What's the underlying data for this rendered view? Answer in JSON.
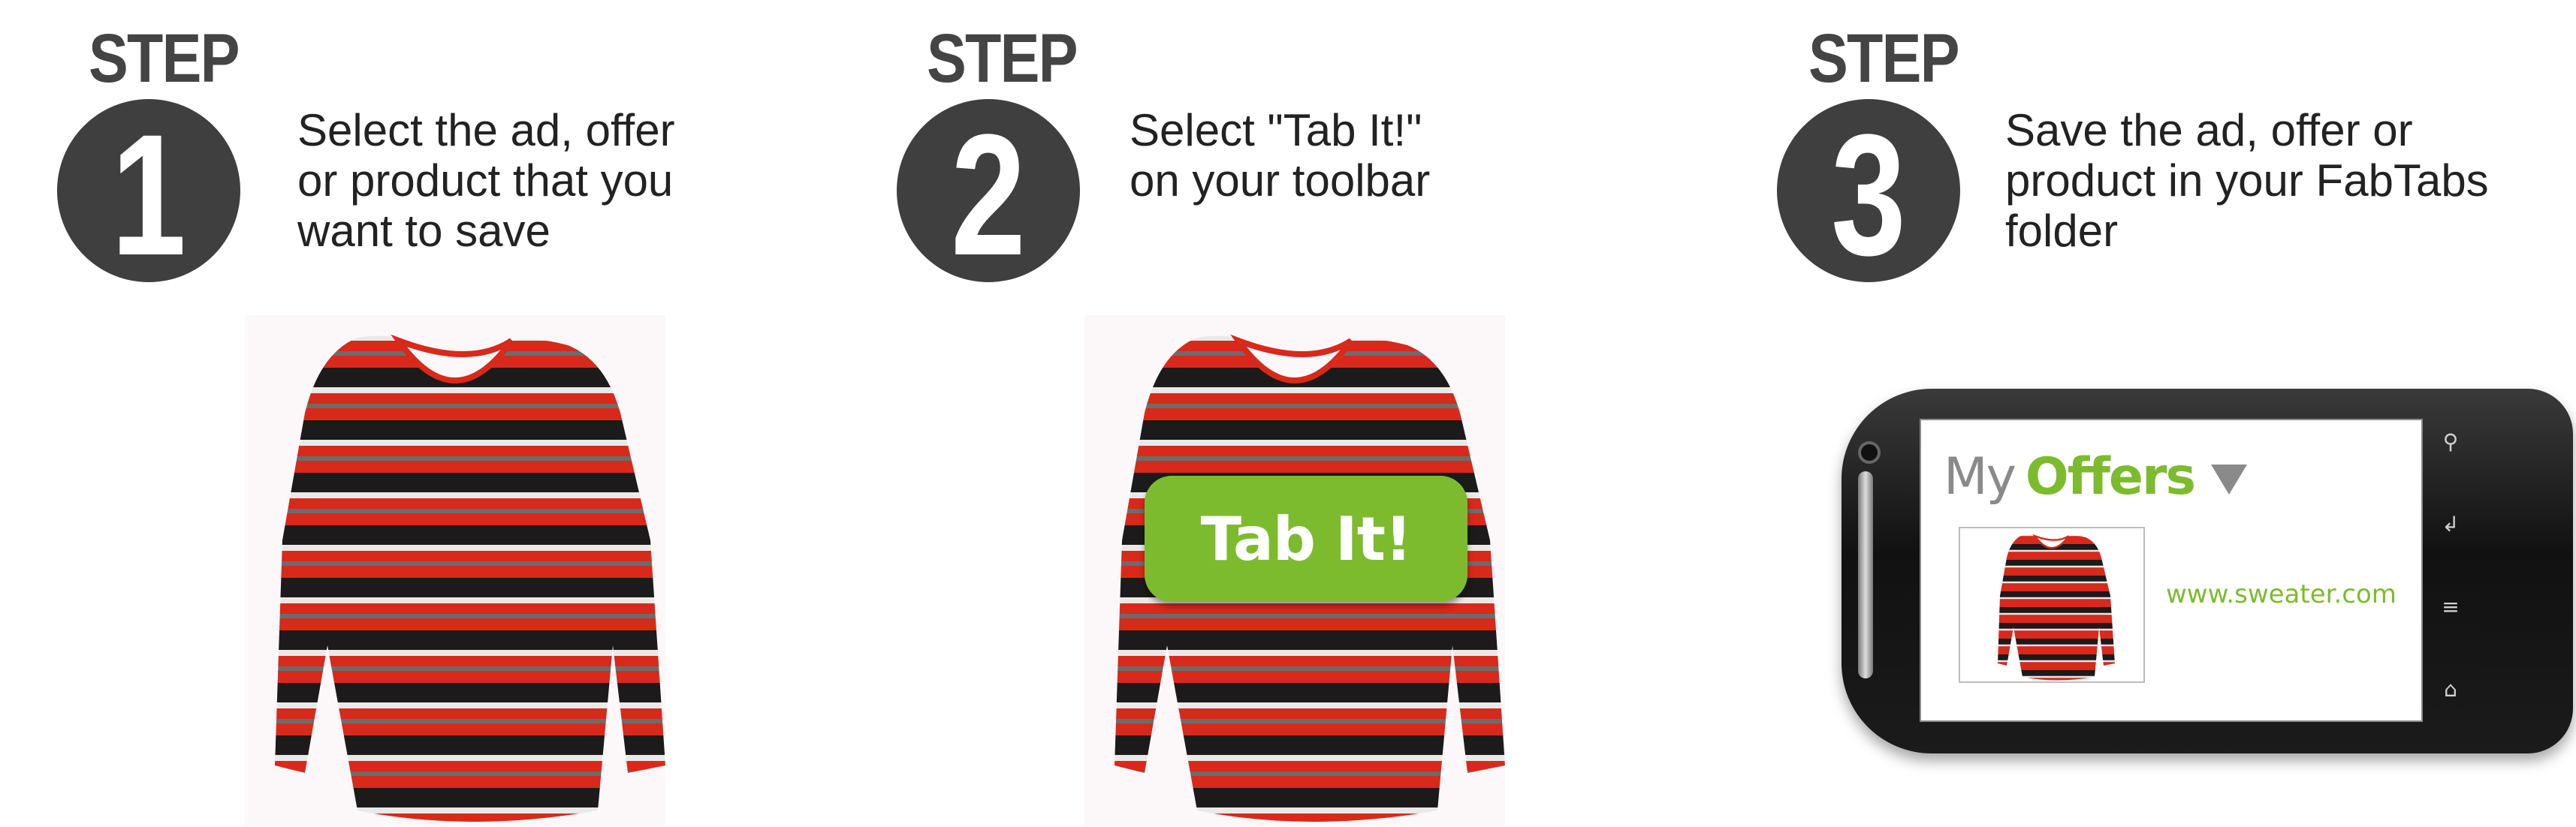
{
  "steps": [
    {
      "label": "STEP",
      "number": "1",
      "text": [
        "Select the ad, offer",
        "or product that you",
        "want to save"
      ]
    },
    {
      "label": "STEP",
      "number": "2",
      "text": [
        "Select \"Tab It!\"",
        "on your toolbar"
      ]
    },
    {
      "label": "STEP",
      "number": "3",
      "text": [
        "Save the ad, offer or",
        "product in your FabTabs",
        "folder"
      ]
    }
  ],
  "tab_button": {
    "label": "Tab It!"
  },
  "phone": {
    "title_my": "My",
    "title_offers": "Offers",
    "url": "www.sweater.com",
    "soft_keys": [
      "search-icon",
      "back-icon",
      "menu-icon",
      "home-icon"
    ]
  },
  "colors": {
    "accent_green": "#7dbb2e",
    "badge_dark": "#3f3f3f",
    "sweater_red": "#d8291a",
    "sweater_black": "#1c1a1a"
  }
}
